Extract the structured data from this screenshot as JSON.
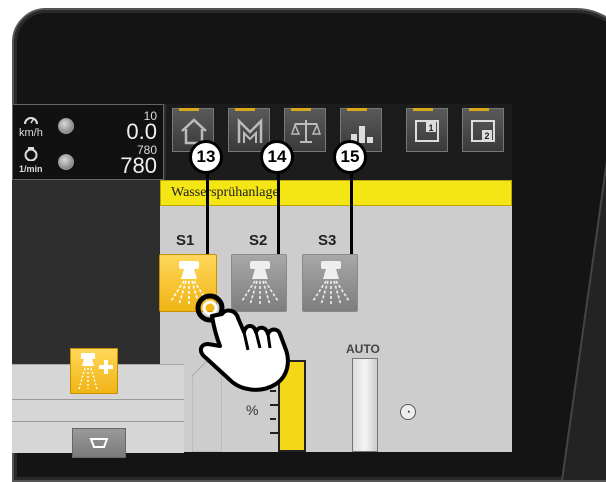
{
  "readout": {
    "speed_unit": "km/h",
    "speed_setpoint": "10",
    "speed_value": "0.0",
    "rpm_unit": "1/min",
    "rpm_setpoint": "780",
    "rpm_value": "780"
  },
  "tabs": [
    {
      "icon": "home-icon"
    },
    {
      "icon": "mill-icon"
    },
    {
      "icon": "scale-icon"
    },
    {
      "icon": "bar-chart-icon"
    },
    {
      "icon": "page-1-icon",
      "label": "1"
    },
    {
      "icon": "page-2-icon",
      "label": "2"
    }
  ],
  "section_title": "Wassersprühanlage",
  "sprayers": [
    {
      "label": "S1",
      "state": "active",
      "callout": "13"
    },
    {
      "label": "S2",
      "state": "inactive",
      "callout": "14"
    },
    {
      "label": "S3",
      "state": "inactive",
      "callout": "15"
    }
  ],
  "controls": {
    "auto_label": "AUTO",
    "percent_label": "%"
  },
  "colors": {
    "header_yellow": "#f4e514",
    "active_button": "#f0b415",
    "accent_tab": "#d7a91a"
  }
}
